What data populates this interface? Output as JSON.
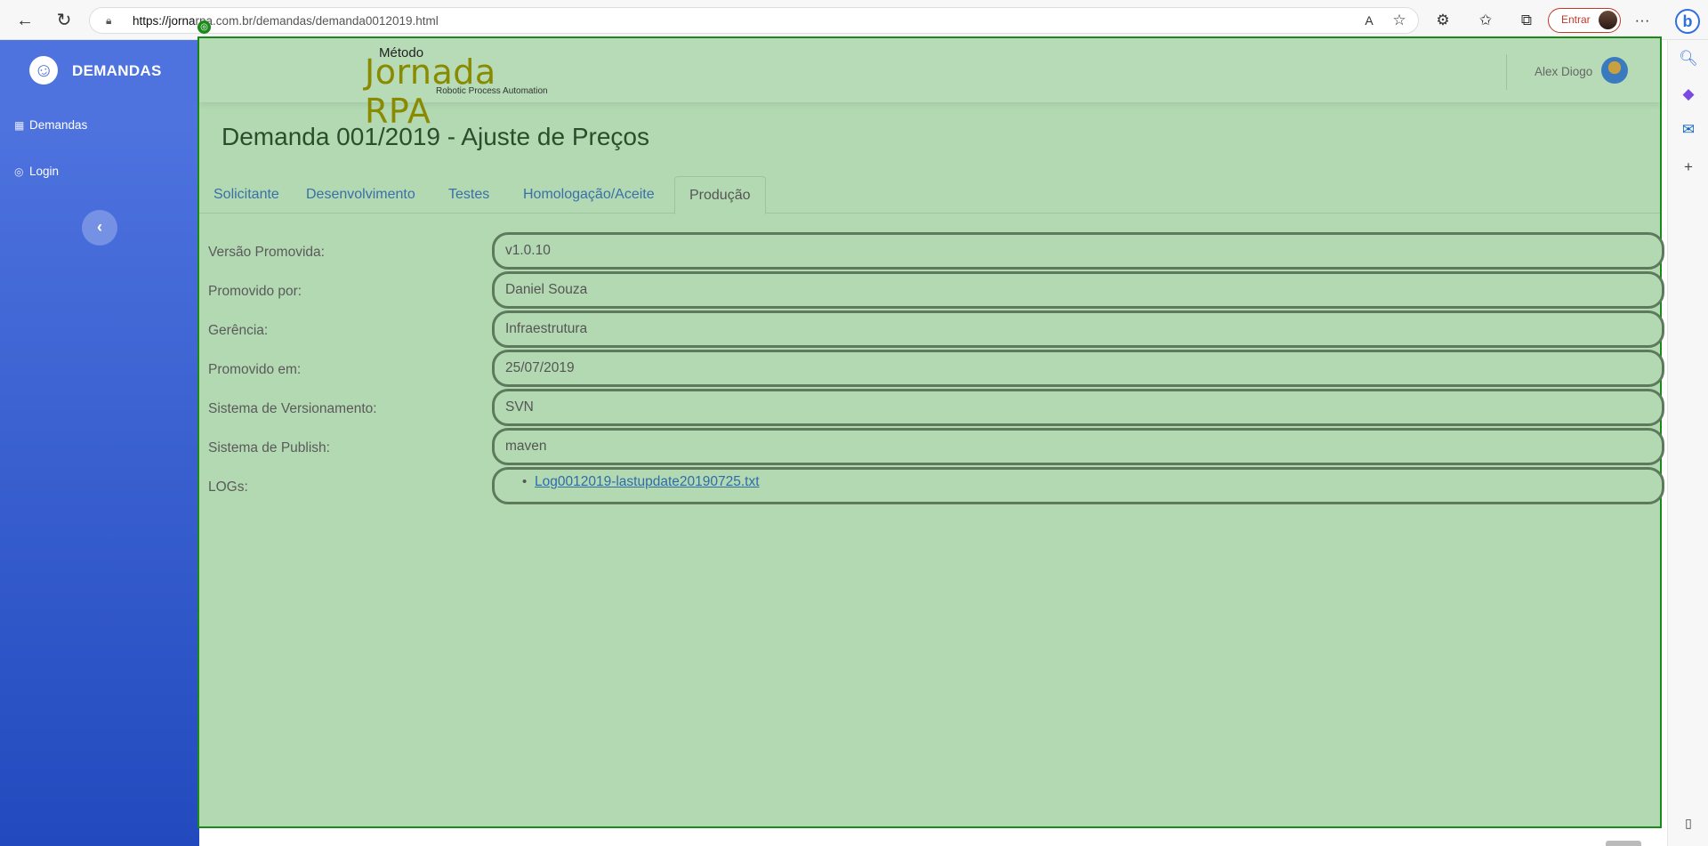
{
  "browser": {
    "url_prefix": "https://jorna",
    "url_rest": "rpa.com.br/demandas/demanda0012019.html",
    "entrar_label": "Entrar",
    "more_label": "···"
  },
  "sidebar": {
    "brand": "DEMANDAS",
    "items": [
      {
        "label": "Demandas",
        "icon": "table-icon"
      },
      {
        "label": "Login",
        "icon": "user-circle-icon"
      }
    ],
    "toggle_symbol": "‹"
  },
  "topbar": {
    "logo_metodo": "Método",
    "logo_main": "Jornada RPA",
    "logo_sub": "Robotic Process Automation",
    "user_name": "Alex Diogo"
  },
  "page": {
    "title": "Demanda 001/2019 - Ajuste de Preços",
    "tabs": [
      {
        "label": "Solicitante",
        "active": false
      },
      {
        "label": "Desenvolvimento",
        "active": false
      },
      {
        "label": "Testes",
        "active": false
      },
      {
        "label": "Homologação/Aceite",
        "active": false
      },
      {
        "label": "Produção",
        "active": true
      }
    ],
    "fields": [
      {
        "label": "Versão Promovida:",
        "value": "v1.0.10"
      },
      {
        "label": "Promovido por:",
        "value": "Daniel Souza"
      },
      {
        "label": "Gerência:",
        "value": "Infraestrutura"
      },
      {
        "label": "Promovido em:",
        "value": "25/07/2019"
      },
      {
        "label": "Sistema de Versionamento:",
        "value": "SVN"
      },
      {
        "label": "Sistema de Publish:",
        "value": "maven"
      }
    ],
    "logs_label": "LOGs:",
    "logs": [
      "Log0012019-lastupdate20190725.txt"
    ]
  },
  "colors": {
    "sidebar_top": "#4e73df",
    "sidebar_bottom": "#224abe",
    "content_bg": "#b3d9b3",
    "content_border": "#1a8a1a",
    "link": "#2f6ca8"
  }
}
